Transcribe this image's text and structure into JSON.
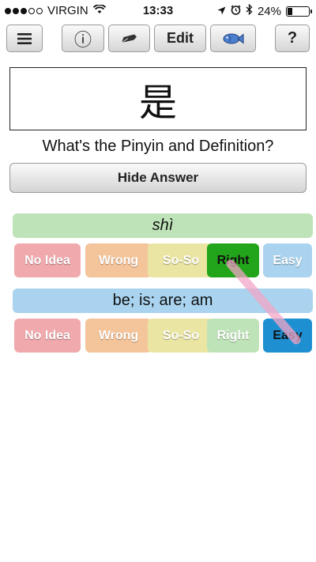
{
  "status_bar": {
    "carrier": "VIRGIN",
    "time": "13:33",
    "battery": "24%",
    "signal_icon": "signal-dots-icon",
    "wifi_icon": "wifi-icon",
    "location_icon": "location-arrow-icon",
    "alarm_icon": "alarm-clock-icon",
    "bluetooth_icon": "bluetooth-icon",
    "battery_icon": "battery-icon"
  },
  "toolbar": {
    "menu_icon": "menu-icon",
    "info_label": "ⓘ",
    "pen_icon": "pen-nib-icon",
    "edit_label": "Edit",
    "fish_icon": "fish-icon",
    "help_label": "?"
  },
  "card": {
    "character": "是",
    "question": "What's the Pinyin and Definition?",
    "hide_answer_label": "Hide Answer"
  },
  "pinyin": {
    "answer": "shì",
    "grades": [
      "No Idea",
      "Wrong",
      "So-So",
      "Right",
      "Easy"
    ],
    "selected": "Right"
  },
  "definition": {
    "answer": "be; is; are; am",
    "grades": [
      "No Idea",
      "Wrong",
      "So-So",
      "Right",
      "Easy"
    ],
    "selected": "Easy"
  },
  "colors": {
    "no_idea": "#f0a9ad",
    "wrong": "#f4c49a",
    "so_so": "#eae5a3",
    "right": "#bfe3b8",
    "right_selected": "#22a51a",
    "easy": "#a9d3ee",
    "easy_selected": "#1e8fd1"
  }
}
